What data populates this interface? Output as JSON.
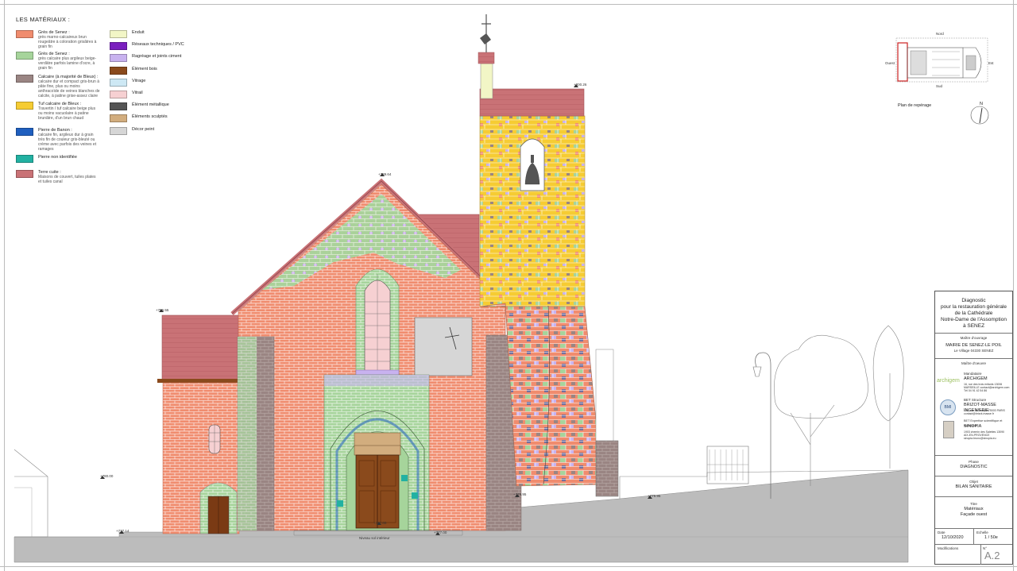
{
  "legend": {
    "title": "LES MATÉRIAUX :",
    "items_left": [
      {
        "color": "#f08c6e",
        "name": "Grès de Senez :",
        "desc": "grès marno-calcaireux brun rougeâtre à coloration grisâtres à grain fin"
      },
      {
        "color": "#a6d49b",
        "name": "Grès de Senez :",
        "desc": "grès calcaire plus argileux beige-verdâtre parfois lamine d'ocre, à grain fin"
      },
      {
        "color": "#9a8583",
        "name": "Calcaire (à majorité de Bleux) :",
        "desc": "calcaire dur et compact gris-brun à pâte fine, plus ou moins anthracoïde de veines blanches de calcite, à patine grise-assez claire"
      },
      {
        "color": "#f6cc33",
        "name": "Tuf calcaire de Bleux :",
        "desc": "Travertin / tuf calcaire beige plus ou moins vacuolaire à patine brunâtre, d'un brun chaud"
      },
      {
        "color": "#1f5fbf",
        "name": "Pierre de Banon :",
        "desc": "calcaire fin, argileux dur à grain très fin de couleur gris-bleuté ou crème avec parfois des veines et ramages"
      },
      {
        "color": "#22b1a2",
        "name": "Pierre non identifiée",
        "desc": ""
      },
      {
        "color": "#c97276",
        "name": "Terre cuite :",
        "desc": "Maisons de couvert, tuiles plates et tuiles canal"
      }
    ],
    "items_right": [
      {
        "color": "#f2f6c6",
        "name": "Enduit"
      },
      {
        "color": "#7a1fbf",
        "name": "Réseaux techniques / PVC"
      },
      {
        "color": "#c8b2ef",
        "name": "Ragréage et joints ciment"
      },
      {
        "color": "#8a4a1c",
        "name": "Élément bois"
      },
      {
        "color": "#cde8f4",
        "name": "Vitrage"
      },
      {
        "color": "#f6d0d2",
        "name": "Vitrail"
      },
      {
        "color": "#555555",
        "name": "Élément métallique"
      },
      {
        "color": "#d2ad7e",
        "name": "Éléments sculptés"
      },
      {
        "color": "#d6d6d6",
        "name": "Décor peint"
      }
    ]
  },
  "elevations": {
    "tower_top": "+800.26",
    "gable_top": "+789.64",
    "left_roof": "+786.55",
    "left_ground": "+780.00",
    "ground_1": "+777.14",
    "door": "+777.00",
    "ground_2": "+777.00",
    "right_1": "+779.95",
    "right_2": "+779.95"
  },
  "ground_label": "Niveau sol intérieur",
  "plan": {
    "title": "Plan de repérage",
    "north": "Nord",
    "south": "Sud",
    "west": "Ouest",
    "east": "Est",
    "north_arrow": "N"
  },
  "title_block": {
    "project_lines": [
      "Diagnostic",
      "pour la restauration générale",
      "de la Cathédrale",
      "Notre-Dame de l'Assomption",
      "à SENEZ"
    ],
    "moa_label": "Maître d'ouvrage",
    "moa_name": "MAIRIE DE SENEZ-LE POIL",
    "moa_addr": "Le Village 04330 SENEZ",
    "moe_label": "Maître d'oeuvre",
    "mandataire_label": "Mandataire",
    "mandataire_name": "ARCHIGEM",
    "mandataire_addr": "16, rue des trois enfants 13006 MARSEILLE contact@archigem.com Tél 04 91 42 54 86",
    "mandataire_logo": "archigem",
    "bet_label": "BET Structure",
    "bet_name": "BRIZOT-MASSE INGENIERIE",
    "bet_addr": "134, rue du Temple 75003 PARIS contact@brizot-masse.fr",
    "bet_logo": "BMI",
    "sinopia_label": "BET Expertise scientifique et technique",
    "sinopia_name": "SINOPIA",
    "sinopia_addr": "1903 chemin des Salettes 13090 AIX-EN-PROVENCE sinopia.bruno@sinopia.eu",
    "phase_label": "Phase",
    "phase": "DIAGNOSTIC",
    "objet_label": "Objet",
    "objet": "BILAN SANITAIRE",
    "titre_label": "Titre",
    "titre_1": "Matériaux",
    "titre_2": "Façade ouest",
    "date_label": "Date",
    "date": "12/10/2020",
    "echelle_label": "Echelle",
    "echelle": "1 / 50e",
    "modif_label": "Modifications",
    "num_label": "N°",
    "num": "A.2"
  }
}
